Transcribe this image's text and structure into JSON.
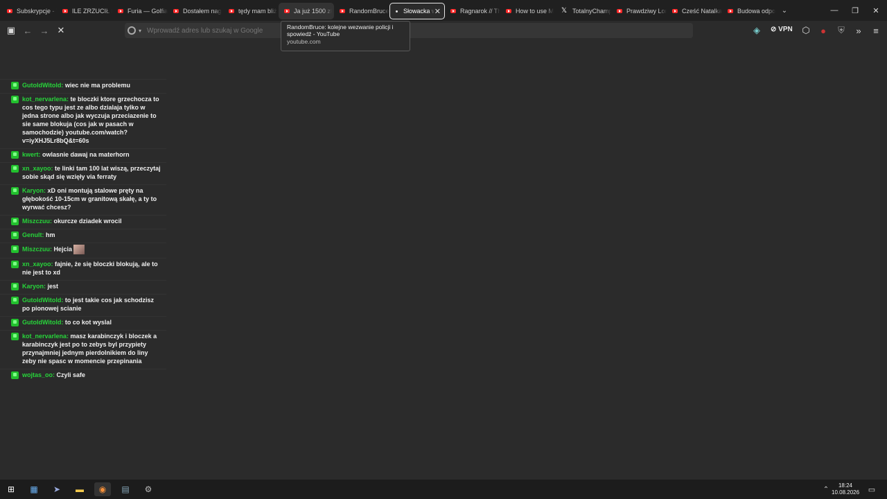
{
  "tabs": [
    {
      "label": "Subskrypcje - Y",
      "icon": "youtube-icon"
    },
    {
      "label": "ILE ZRZUCIŁ P",
      "icon": "youtube-icon"
    },
    {
      "label": "Furia — Golfia",
      "icon": "youtube-icon"
    },
    {
      "label": "Dostałem nag",
      "icon": "youtube-icon"
    },
    {
      "label": "tędy mam bliż",
      "icon": "youtube-icon"
    },
    {
      "label": "Ja już 1500 zł",
      "icon": "youtube-icon"
    },
    {
      "label": "RandomBruce:",
      "icon": "youtube-icon"
    },
    {
      "label": "Słowacka w",
      "icon": "loading-icon"
    },
    {
      "label": "Ragnarok // Th",
      "icon": "youtube-icon"
    },
    {
      "label": "How to use M",
      "icon": "youtube-icon"
    },
    {
      "label": "TotalnyChamp",
      "icon": "x-icon"
    },
    {
      "label": "Prawdziwy Lon",
      "icon": "youtube-icon"
    },
    {
      "label": "Cześć Natalka",
      "icon": "youtube-icon"
    },
    {
      "label": "Budowa odpo",
      "icon": "youtube-icon"
    }
  ],
  "address_bar": {
    "placeholder": "Wprowadź adres lub szukaj w Google"
  },
  "vpn_label": "VPN",
  "tooltip": {
    "title": "RandomBruce: kolejne wezwanie policji i spowiedź - YouTube",
    "url": "youtube.com"
  },
  "chat": [
    {
      "user": "GutoldWitold:",
      "text": "wiec nie ma problemu"
    },
    {
      "user": "kot_nervarlena:",
      "text": "te bloczki ktore grzechocza to cos tego typu jest ze albo dzialaja tylko w jedna strone albo jak wyczuja przeciazenie to sie same blokuja (cos jak w pasach w samochodzie) youtube.com/watch?v=iyXHJ5Lr8bQ&t=60s"
    },
    {
      "user": "kwert:",
      "text": "owlasnie dawaj na materhorn"
    },
    {
      "user": "xn_xayoo:",
      "text": "te linki tam 100 lat wiszą, przeczytaj sobie skąd się wzięły via ferraty"
    },
    {
      "user": "Karyon:",
      "text": "xD oni montują stalowe pręty na głębokość 10-15cm w granitową skałę, a ty to wyrwać chcesz?"
    },
    {
      "user": "Miszczuu:",
      "text": "okurcze dziadek wrocil"
    },
    {
      "user": "Genult:",
      "text": "hm"
    },
    {
      "user": "Miszczuu:",
      "text": "Hejcia"
    },
    {
      "user": "xn_xayoo:",
      "text": "fajnie, że się bloczki blokują, ale to nie jest to xd"
    },
    {
      "user": "Karyon:",
      "text": "jest"
    },
    {
      "user": "GutoldWitold:",
      "text": "to jest takie cos jak schodzisz po pionowej scianie"
    },
    {
      "user": "GutoldWitold:",
      "text": "to co kot wyslal"
    },
    {
      "user": "kot_nervarlena:",
      "text": "masz karabinczyk i bloczek a karabinczyk jest po to zebys byl przypiety przynajmniej jednym pierdolnikiem do liny zeby nie spasc w momencie przepinania"
    },
    {
      "user": "wojtas_oo:",
      "text": "Czyli safe"
    }
  ],
  "clock": {
    "time": "18:24",
    "date": "10.08.2026"
  }
}
